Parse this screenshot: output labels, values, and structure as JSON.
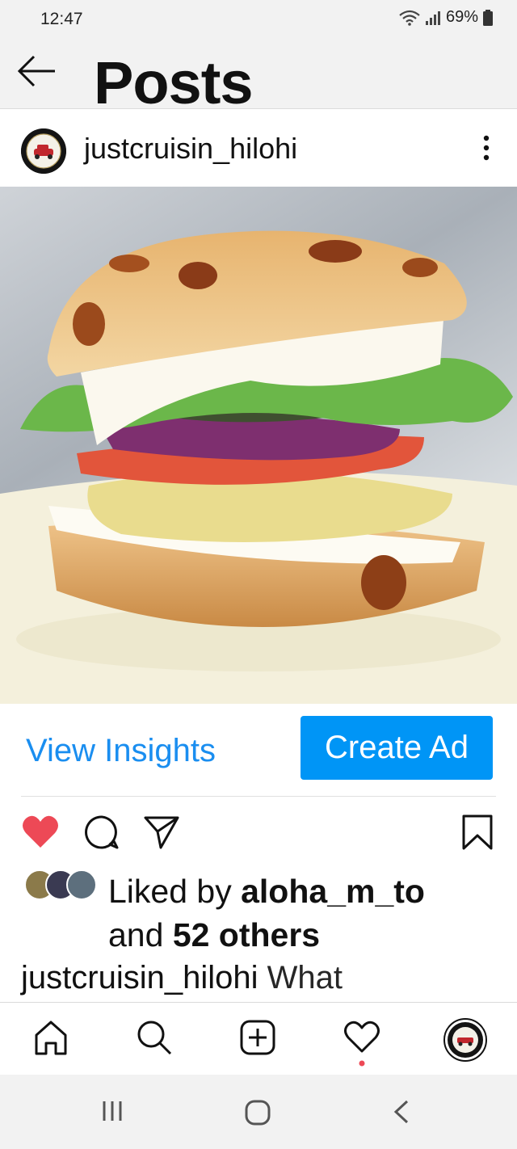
{
  "status_bar": {
    "time": "12:47",
    "battery": "69%"
  },
  "header": {
    "title": "Posts"
  },
  "post": {
    "username": "justcruisin_hilohi",
    "image_description_icon": "sandwich-photo"
  },
  "actions": {
    "view_insights": "View Insights",
    "create_ad": "Create Ad"
  },
  "likes": {
    "prefix": "Liked by ",
    "user": "aloha_m_to",
    "and": "and ",
    "count": "52 others"
  },
  "caption": {
    "user": "justcruisin_hilohi",
    "text": " What"
  },
  "colors": {
    "link_blue": "#1a8ef0",
    "button_blue": "#0095f6",
    "heart_red": "#ed4956",
    "activity_dot": "#ed4956"
  },
  "bottom_nav": [
    "home-icon",
    "search-icon",
    "add-post-icon",
    "activity-heart-icon",
    "profile-avatar"
  ],
  "system_nav": [
    "recent-apps-icon",
    "home-circle-icon",
    "back-chevron-icon"
  ]
}
